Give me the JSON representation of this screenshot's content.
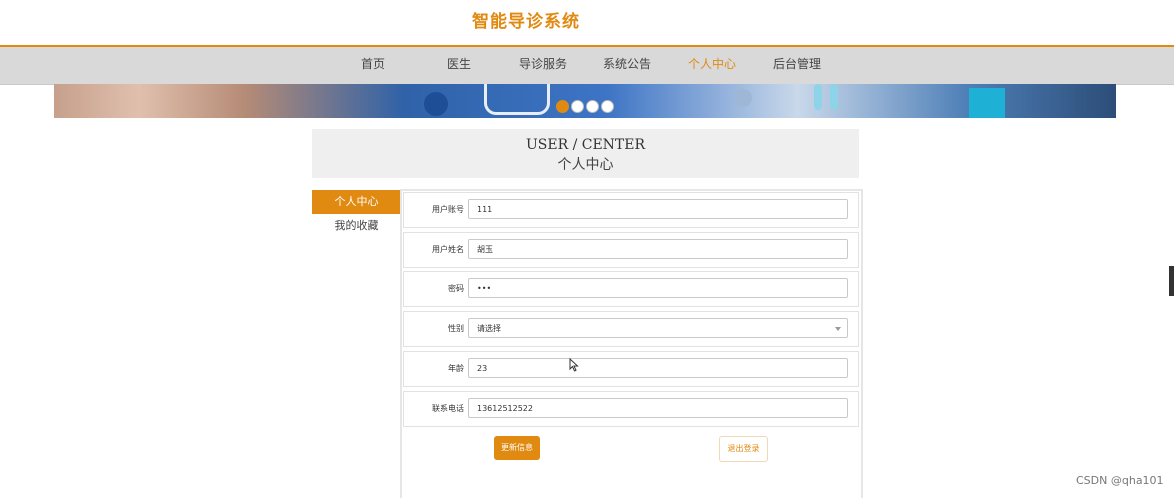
{
  "site": {
    "title": "智能导诊系统"
  },
  "nav": {
    "items": [
      {
        "label": "首页",
        "active": false
      },
      {
        "label": "医生",
        "active": false
      },
      {
        "label": "导诊服务",
        "active": false
      },
      {
        "label": "系统公告",
        "active": false
      },
      {
        "label": "个人中心",
        "active": true
      },
      {
        "label": "后台管理",
        "active": false
      }
    ]
  },
  "banner": {
    "dots": 4,
    "active_dot": 0
  },
  "page_header": {
    "en": "USER / CENTER",
    "cn": "个人中心"
  },
  "sidebar": {
    "items": [
      {
        "label": "个人中心",
        "active": true
      },
      {
        "label": "我的收藏",
        "active": false
      }
    ]
  },
  "form": {
    "fields": [
      {
        "label": "用户账号",
        "value": "111"
      },
      {
        "label": "用户姓名",
        "value": "胡玉"
      },
      {
        "label": "密码",
        "value": "•••"
      },
      {
        "label": "性别",
        "value": "请选择"
      },
      {
        "label": "年龄",
        "value": "23"
      },
      {
        "label": "联系电话",
        "value": "13612512522"
      }
    ],
    "update_label": "更新信息",
    "logout_label": "退出登录"
  },
  "watermark": "CSDN @qha101",
  "colors": {
    "accent": "#e08a12",
    "nav_bg": "#d9d9d9"
  }
}
